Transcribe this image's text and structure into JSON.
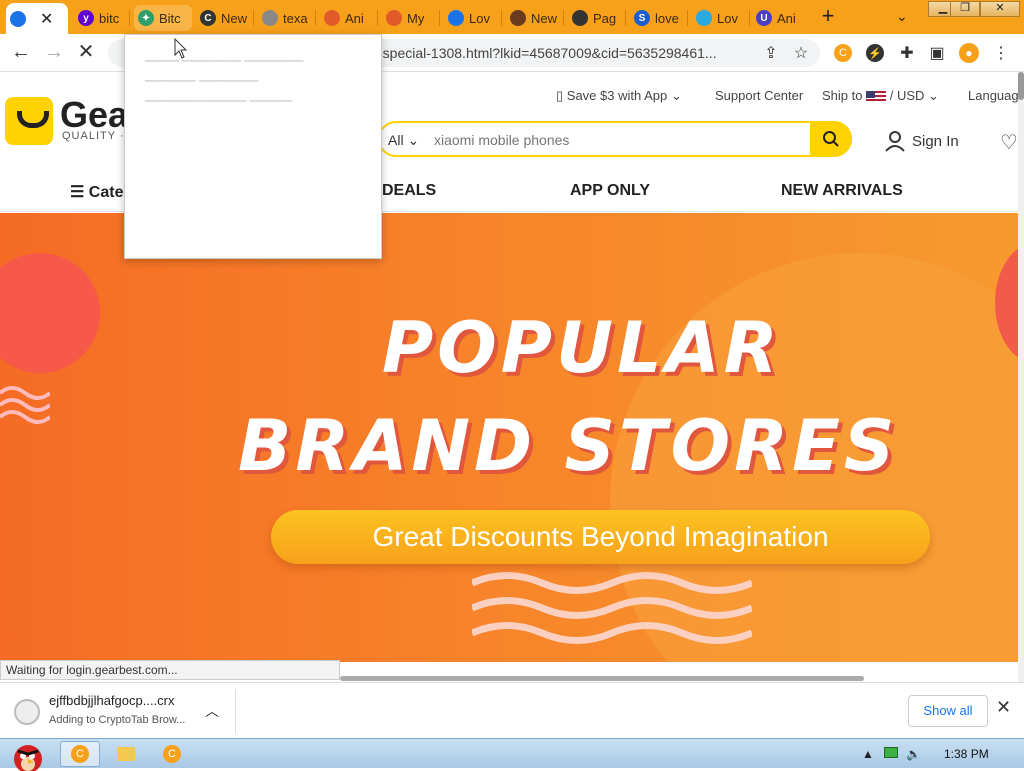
{
  "tabs": [
    {
      "label": "",
      "color": "#1a73e8"
    },
    {
      "label": "bitc",
      "color": "#6001d2"
    },
    {
      "label": "Bitc",
      "color": "#2e9e6b"
    },
    {
      "label": "New",
      "color": "#333333"
    },
    {
      "label": "texa",
      "color": "#888888"
    },
    {
      "label": "Ani",
      "color": "#e05a2a"
    },
    {
      "label": "My",
      "color": "#e05a2a"
    },
    {
      "label": "Lov",
      "color": "#1a73e8"
    },
    {
      "label": "New",
      "color": "#6b3a1f"
    },
    {
      "label": "Pag",
      "color": "#333333"
    },
    {
      "label": "love",
      "color": "#1a5fd1"
    },
    {
      "label": "Lov",
      "color": "#2aa8e0"
    },
    {
      "label": "Ani",
      "color": "#4a3ec2"
    }
  ],
  "toolbar": {
    "url": "-special-1308.html?lkid=45687009&cid=5635298461..."
  },
  "header": {
    "logo_text": "Gea",
    "logo_tag": "QUALITY ·",
    "save_app": "Save $3 with App",
    "support": "Support Center",
    "ship_to": "Ship to",
    "currency": "/ USD",
    "language": "Languag",
    "search_category": "All",
    "search_placeholder": "xiaomi mobile phones",
    "sign_in": "Sign In"
  },
  "nav": {
    "categories": "Cate",
    "deals": "DEALS",
    "app_only": "APP ONLY",
    "new_arrivals": "NEW ARRIVALS"
  },
  "banner": {
    "line1": "POPULAR",
    "line2": "BRAND STORES",
    "pill": "Great Discounts Beyond Imagination"
  },
  "status": {
    "text": "Waiting for login.gearbest.com..."
  },
  "download": {
    "filename": "ejffbdbjjlhafgocp....crx",
    "status": "Adding to CryptoTab Brow...",
    "show_all": "Show all"
  },
  "taskbar": {
    "clock": "1:38 PM"
  },
  "colors": {
    "tabstrip": "#f7a11a",
    "accent": "#ffd200",
    "banner": "#f7852a"
  }
}
